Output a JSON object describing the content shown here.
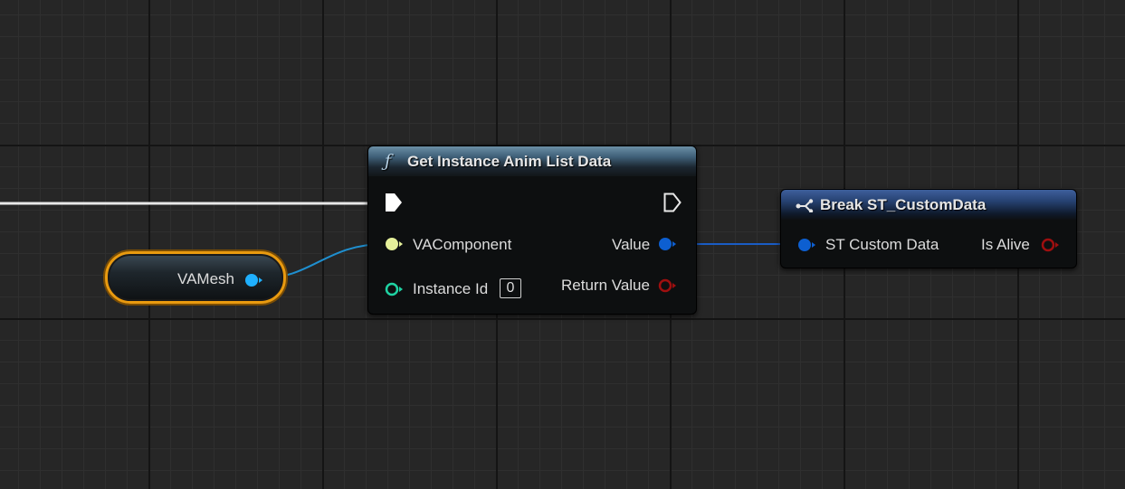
{
  "graph": {
    "variable_node": {
      "label": "VAMesh",
      "pin_color": "#1fb0ff",
      "outline_color": "#e99a0f"
    },
    "function_node": {
      "icon": "function-icon",
      "title": "Get Instance Anim List Data",
      "inputs": [
        {
          "label": "VAComponent",
          "pin": "object-pin",
          "color": "#e5f09a"
        },
        {
          "label": "Instance Id",
          "pin": "integer-pin",
          "color": "#1fd3a3",
          "value": "0"
        }
      ],
      "outputs": [
        {
          "label": "Value",
          "pin": "struct-pin",
          "color": "#0d5fd1"
        },
        {
          "label": "Return Value",
          "pin": "boolean-pin",
          "color": "#9e0f0f"
        }
      ]
    },
    "break_node": {
      "icon": "break-struct-icon",
      "title": "Break ST_CustomData",
      "inputs": [
        {
          "label": "ST Custom Data",
          "pin": "struct-pin",
          "color": "#0d5fd1"
        }
      ],
      "outputs": [
        {
          "label": "Is Alive",
          "pin": "boolean-pin",
          "color": "#9e0f0f"
        }
      ]
    }
  }
}
